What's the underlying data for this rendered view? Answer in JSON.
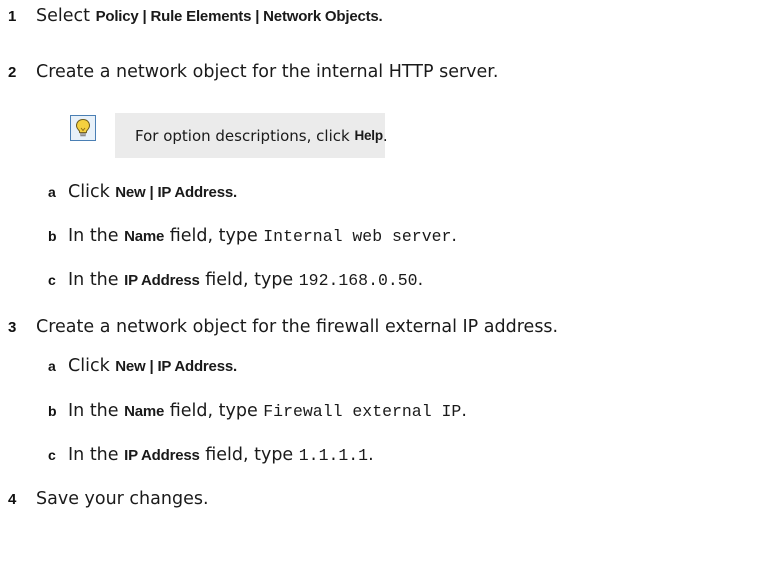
{
  "steps": [
    {
      "number": "1",
      "text_prefix": "Select ",
      "ui_path": "Policy | Rule Elements | Network Objects",
      "text_suffix": "."
    },
    {
      "number": "2",
      "text": "Create a network object for the internal HTTP server.",
      "tip": {
        "icon": "lightbulb-icon",
        "text_prefix": "For option descriptions, click ",
        "ui": "Help",
        "text_suffix": "."
      },
      "substeps": [
        {
          "letter": "a",
          "text_prefix": "Click ",
          "ui": "New | IP Address",
          "text_suffix": "."
        },
        {
          "letter": "b",
          "text_prefix": "In the ",
          "ui": "Name",
          "text_middle": " field, type ",
          "code": "Internal web server",
          "text_suffix": "."
        },
        {
          "letter": "c",
          "text_prefix": "In the ",
          "ui": "IP Address",
          "text_middle": " field, type ",
          "code": "192.168.0.50",
          "text_suffix": "."
        }
      ]
    },
    {
      "number": "3",
      "text": "Create a network object for the firewall external IP address.",
      "substeps": [
        {
          "letter": "a",
          "text_prefix": "Click ",
          "ui": "New | IP Address",
          "text_suffix": "."
        },
        {
          "letter": "b",
          "text_prefix": "In the ",
          "ui": "Name",
          "text_middle": " field, type ",
          "code": "Firewall external IP",
          "text_suffix": "."
        },
        {
          "letter": "c",
          "text_prefix": "In the ",
          "ui": "IP Address",
          "text_middle": " field, type ",
          "code": "1.1.1.1",
          "text_suffix": "."
        }
      ]
    },
    {
      "number": "4",
      "text": "Save your changes."
    }
  ],
  "colors": {
    "tip_background": "#ebebeb",
    "icon_border": "#4a7fb4",
    "icon_fill": "#f4d03f"
  }
}
